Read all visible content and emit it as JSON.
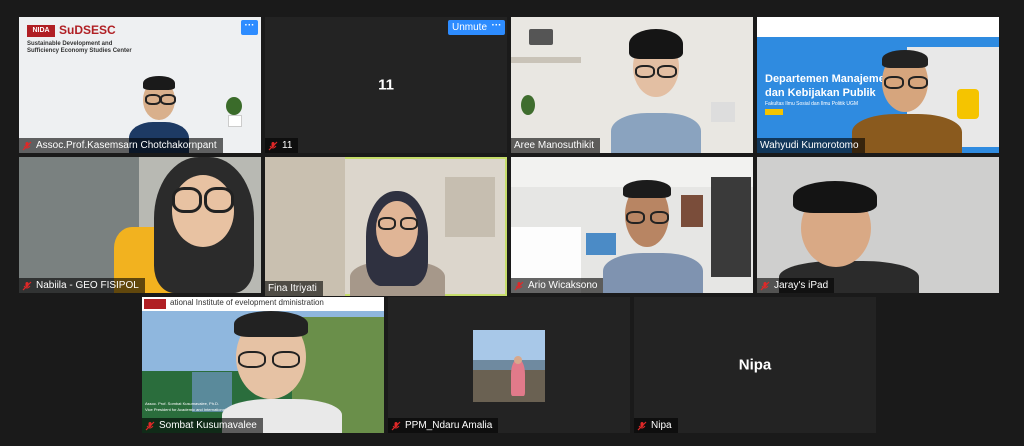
{
  "participants": [
    {
      "name": "Assoc.Prof.Kasemsarn Chotchakornpant",
      "muted": true
    },
    {
      "name": "11",
      "muted": true,
      "display": "11",
      "unmute_label": "Unmute"
    },
    {
      "name": "Aree Manosuthikit",
      "muted": false
    },
    {
      "name": "Wahyudi Kumorotomo",
      "muted": false
    },
    {
      "name": "Nabiila - GEO FISIPOL",
      "muted": true
    },
    {
      "name": "Fina Itriyati",
      "muted": false,
      "active_speaker": true
    },
    {
      "name": "Ario Wicaksono",
      "muted": true
    },
    {
      "name": "Jaray's iPad",
      "muted": true
    },
    {
      "name": "Sombat Kusumavalee",
      "muted": true
    },
    {
      "name": "PPM_Ndaru Amalia",
      "muted": true
    },
    {
      "name": "Nipa",
      "muted": true,
      "display": "Nipa"
    }
  ],
  "backgrounds": {
    "sudsesc_logo": "NIDA",
    "sudsesc_title": "SuDSESC",
    "sudsesc_line1": "Sustainable Development and",
    "sudsesc_line2": "Sufficiency Economy Studies Center",
    "dept_line1": "Departemen Manajemen",
    "dept_line2": "dan Kebijakan Publik",
    "dept_sub": "Fakultas Ilmu Sosial dan Ilmu Politik UGM",
    "nida_banner": "ational Institute of   evelopment   dministration",
    "sombat_caption1": "Assoc. Prof. Sombat Kusumavalee, Ph.D.",
    "sombat_caption2": "Vice President for Academic and International Affairs"
  },
  "more_label": "···",
  "colors": {
    "accent": "#2d8cff",
    "active_border": "#c6dd6b",
    "muted_icon": "#e02828"
  }
}
